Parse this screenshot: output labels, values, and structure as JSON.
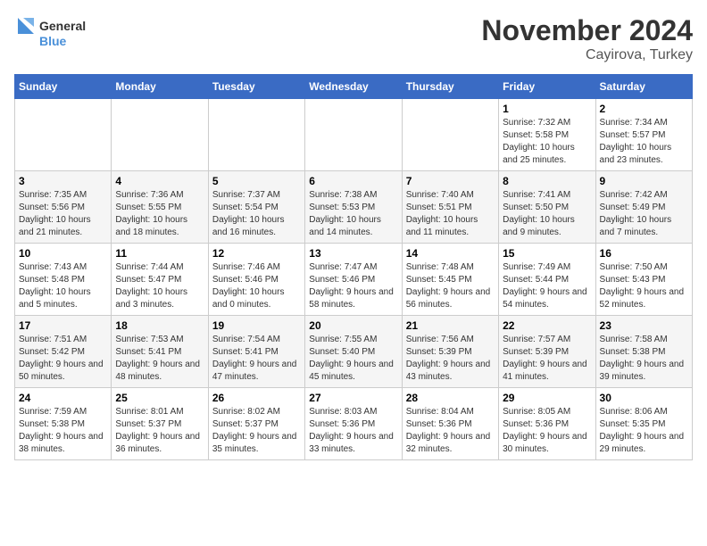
{
  "logo": {
    "text_general": "General",
    "text_blue": "Blue"
  },
  "title": "November 2024",
  "location": "Cayirova, Turkey",
  "days_of_week": [
    "Sunday",
    "Monday",
    "Tuesday",
    "Wednesday",
    "Thursday",
    "Friday",
    "Saturday"
  ],
  "weeks": [
    [
      {
        "day": "",
        "info": ""
      },
      {
        "day": "",
        "info": ""
      },
      {
        "day": "",
        "info": ""
      },
      {
        "day": "",
        "info": ""
      },
      {
        "day": "",
        "info": ""
      },
      {
        "day": "1",
        "info": "Sunrise: 7:32 AM\nSunset: 5:58 PM\nDaylight: 10 hours and 25 minutes."
      },
      {
        "day": "2",
        "info": "Sunrise: 7:34 AM\nSunset: 5:57 PM\nDaylight: 10 hours and 23 minutes."
      }
    ],
    [
      {
        "day": "3",
        "info": "Sunrise: 7:35 AM\nSunset: 5:56 PM\nDaylight: 10 hours and 21 minutes."
      },
      {
        "day": "4",
        "info": "Sunrise: 7:36 AM\nSunset: 5:55 PM\nDaylight: 10 hours and 18 minutes."
      },
      {
        "day": "5",
        "info": "Sunrise: 7:37 AM\nSunset: 5:54 PM\nDaylight: 10 hours and 16 minutes."
      },
      {
        "day": "6",
        "info": "Sunrise: 7:38 AM\nSunset: 5:53 PM\nDaylight: 10 hours and 14 minutes."
      },
      {
        "day": "7",
        "info": "Sunrise: 7:40 AM\nSunset: 5:51 PM\nDaylight: 10 hours and 11 minutes."
      },
      {
        "day": "8",
        "info": "Sunrise: 7:41 AM\nSunset: 5:50 PM\nDaylight: 10 hours and 9 minutes."
      },
      {
        "day": "9",
        "info": "Sunrise: 7:42 AM\nSunset: 5:49 PM\nDaylight: 10 hours and 7 minutes."
      }
    ],
    [
      {
        "day": "10",
        "info": "Sunrise: 7:43 AM\nSunset: 5:48 PM\nDaylight: 10 hours and 5 minutes."
      },
      {
        "day": "11",
        "info": "Sunrise: 7:44 AM\nSunset: 5:47 PM\nDaylight: 10 hours and 3 minutes."
      },
      {
        "day": "12",
        "info": "Sunrise: 7:46 AM\nSunset: 5:46 PM\nDaylight: 10 hours and 0 minutes."
      },
      {
        "day": "13",
        "info": "Sunrise: 7:47 AM\nSunset: 5:46 PM\nDaylight: 9 hours and 58 minutes."
      },
      {
        "day": "14",
        "info": "Sunrise: 7:48 AM\nSunset: 5:45 PM\nDaylight: 9 hours and 56 minutes."
      },
      {
        "day": "15",
        "info": "Sunrise: 7:49 AM\nSunset: 5:44 PM\nDaylight: 9 hours and 54 minutes."
      },
      {
        "day": "16",
        "info": "Sunrise: 7:50 AM\nSunset: 5:43 PM\nDaylight: 9 hours and 52 minutes."
      }
    ],
    [
      {
        "day": "17",
        "info": "Sunrise: 7:51 AM\nSunset: 5:42 PM\nDaylight: 9 hours and 50 minutes."
      },
      {
        "day": "18",
        "info": "Sunrise: 7:53 AM\nSunset: 5:41 PM\nDaylight: 9 hours and 48 minutes."
      },
      {
        "day": "19",
        "info": "Sunrise: 7:54 AM\nSunset: 5:41 PM\nDaylight: 9 hours and 47 minutes."
      },
      {
        "day": "20",
        "info": "Sunrise: 7:55 AM\nSunset: 5:40 PM\nDaylight: 9 hours and 45 minutes."
      },
      {
        "day": "21",
        "info": "Sunrise: 7:56 AM\nSunset: 5:39 PM\nDaylight: 9 hours and 43 minutes."
      },
      {
        "day": "22",
        "info": "Sunrise: 7:57 AM\nSunset: 5:39 PM\nDaylight: 9 hours and 41 minutes."
      },
      {
        "day": "23",
        "info": "Sunrise: 7:58 AM\nSunset: 5:38 PM\nDaylight: 9 hours and 39 minutes."
      }
    ],
    [
      {
        "day": "24",
        "info": "Sunrise: 7:59 AM\nSunset: 5:38 PM\nDaylight: 9 hours and 38 minutes."
      },
      {
        "day": "25",
        "info": "Sunrise: 8:01 AM\nSunset: 5:37 PM\nDaylight: 9 hours and 36 minutes."
      },
      {
        "day": "26",
        "info": "Sunrise: 8:02 AM\nSunset: 5:37 PM\nDaylight: 9 hours and 35 minutes."
      },
      {
        "day": "27",
        "info": "Sunrise: 8:03 AM\nSunset: 5:36 PM\nDaylight: 9 hours and 33 minutes."
      },
      {
        "day": "28",
        "info": "Sunrise: 8:04 AM\nSunset: 5:36 PM\nDaylight: 9 hours and 32 minutes."
      },
      {
        "day": "29",
        "info": "Sunrise: 8:05 AM\nSunset: 5:36 PM\nDaylight: 9 hours and 30 minutes."
      },
      {
        "day": "30",
        "info": "Sunrise: 8:06 AM\nSunset: 5:35 PM\nDaylight: 9 hours and 29 minutes."
      }
    ]
  ]
}
